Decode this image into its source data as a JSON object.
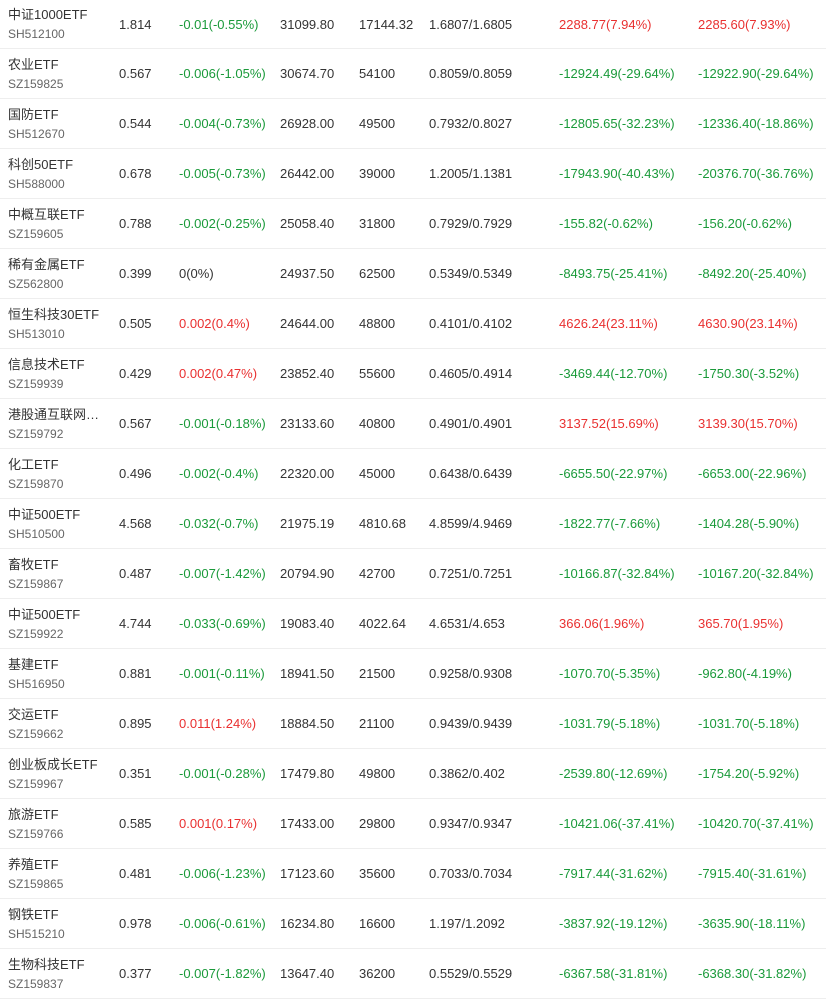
{
  "colors": {
    "up": "#e93030",
    "down": "#1a9a3a",
    "flat": "#333333"
  },
  "rows": [
    {
      "name": "中证1000ETF",
      "code": "SH512100",
      "price": "1.814",
      "change": "-0.01(-0.55%)",
      "change_dir": "down",
      "f1": "31099.80",
      "f2": "17144.32",
      "f3": "1.6807/1.6805",
      "f4": "2288.77(7.94%)",
      "f4_dir": "up",
      "f5": "2285.60(7.93%)",
      "f5_dir": "up"
    },
    {
      "name": "农业ETF",
      "code": "SZ159825",
      "price": "0.567",
      "change": "-0.006(-1.05%)",
      "change_dir": "down",
      "f1": "30674.70",
      "f2": "54100",
      "f3": "0.8059/0.8059",
      "f4": "-12924.49(-29.64%)",
      "f4_dir": "down",
      "f5": "-12922.90(-29.64%)",
      "f5_dir": "down"
    },
    {
      "name": "国防ETF",
      "code": "SH512670",
      "price": "0.544",
      "change": "-0.004(-0.73%)",
      "change_dir": "down",
      "f1": "26928.00",
      "f2": "49500",
      "f3": "0.7932/0.8027",
      "f4": "-12805.65(-32.23%)",
      "f4_dir": "down",
      "f5": "-12336.40(-18.86%)",
      "f5_dir": "down"
    },
    {
      "name": "科创50ETF",
      "code": "SH588000",
      "price": "0.678",
      "change": "-0.005(-0.73%)",
      "change_dir": "down",
      "f1": "26442.00",
      "f2": "39000",
      "f3": "1.2005/1.1381",
      "f4": "-17943.90(-40.43%)",
      "f4_dir": "down",
      "f5": "-20376.70(-36.76%)",
      "f5_dir": "down"
    },
    {
      "name": "中概互联ETF",
      "code": "SZ159605",
      "price": "0.788",
      "change": "-0.002(-0.25%)",
      "change_dir": "down",
      "f1": "25058.40",
      "f2": "31800",
      "f3": "0.7929/0.7929",
      "f4": "-155.82(-0.62%)",
      "f4_dir": "down",
      "f5": "-156.20(-0.62%)",
      "f5_dir": "down"
    },
    {
      "name": "稀有金属ETF",
      "code": "SZ562800",
      "price": "0.399",
      "change": "0(0%)",
      "change_dir": "flat",
      "f1": "24937.50",
      "f2": "62500",
      "f3": "0.5349/0.5349",
      "f4": "-8493.75(-25.41%)",
      "f4_dir": "down",
      "f5": "-8492.20(-25.40%)",
      "f5_dir": "down"
    },
    {
      "name": "恒生科技30ETF",
      "code": "SH513010",
      "price": "0.505",
      "change": "0.002(0.4%)",
      "change_dir": "up",
      "f1": "24644.00",
      "f2": "48800",
      "f3": "0.4101/0.4102",
      "f4": "4626.24(23.11%)",
      "f4_dir": "up",
      "f5": "4630.90(23.14%)",
      "f5_dir": "up"
    },
    {
      "name": "信息技术ETF",
      "code": "SZ159939",
      "price": "0.429",
      "change": "0.002(0.47%)",
      "change_dir": "up",
      "f1": "23852.40",
      "f2": "55600",
      "f3": "0.4605/0.4914",
      "f4": "-3469.44(-12.70%)",
      "f4_dir": "down",
      "f5": "-1750.30(-3.52%)",
      "f5_dir": "down"
    },
    {
      "name": "港股通互联网…",
      "code": "SZ159792",
      "price": "0.567",
      "change": "-0.001(-0.18%)",
      "change_dir": "down",
      "f1": "23133.60",
      "f2": "40800",
      "f3": "0.4901/0.4901",
      "f4": "3137.52(15.69%)",
      "f4_dir": "up",
      "f5": "3139.30(15.70%)",
      "f5_dir": "up"
    },
    {
      "name": "化工ETF",
      "code": "SZ159870",
      "price": "0.496",
      "change": "-0.002(-0.4%)",
      "change_dir": "down",
      "f1": "22320.00",
      "f2": "45000",
      "f3": "0.6438/0.6439",
      "f4": "-6655.50(-22.97%)",
      "f4_dir": "down",
      "f5": "-6653.00(-22.96%)",
      "f5_dir": "down"
    },
    {
      "name": "中证500ETF",
      "code": "SH510500",
      "price": "4.568",
      "change": "-0.032(-0.7%)",
      "change_dir": "down",
      "f1": "21975.19",
      "f2": "4810.68",
      "f3": "4.8599/4.9469",
      "f4": "-1822.77(-7.66%)",
      "f4_dir": "down",
      "f5": "-1404.28(-5.90%)",
      "f5_dir": "down"
    },
    {
      "name": "畜牧ETF",
      "code": "SZ159867",
      "price": "0.487",
      "change": "-0.007(-1.42%)",
      "change_dir": "down",
      "f1": "20794.90",
      "f2": "42700",
      "f3": "0.7251/0.7251",
      "f4": "-10166.87(-32.84%)",
      "f4_dir": "down",
      "f5": "-10167.20(-32.84%)",
      "f5_dir": "down"
    },
    {
      "name": "中证500ETF",
      "code": "SZ159922",
      "price": "4.744",
      "change": "-0.033(-0.69%)",
      "change_dir": "down",
      "f1": "19083.40",
      "f2": "4022.64",
      "f3": "4.6531/4.653",
      "f4": "366.06(1.96%)",
      "f4_dir": "up",
      "f5": "365.70(1.95%)",
      "f5_dir": "up"
    },
    {
      "name": "基建ETF",
      "code": "SH516950",
      "price": "0.881",
      "change": "-0.001(-0.11%)",
      "change_dir": "down",
      "f1": "18941.50",
      "f2": "21500",
      "f3": "0.9258/0.9308",
      "f4": "-1070.70(-5.35%)",
      "f4_dir": "down",
      "f5": "-962.80(-4.19%)",
      "f5_dir": "down"
    },
    {
      "name": "交运ETF",
      "code": "SZ159662",
      "price": "0.895",
      "change": "0.011(1.24%)",
      "change_dir": "up",
      "f1": "18884.50",
      "f2": "21100",
      "f3": "0.9439/0.9439",
      "f4": "-1031.79(-5.18%)",
      "f4_dir": "down",
      "f5": "-1031.70(-5.18%)",
      "f5_dir": "down"
    },
    {
      "name": "创业板成长ETF",
      "code": "SZ159967",
      "price": "0.351",
      "change": "-0.001(-0.28%)",
      "change_dir": "down",
      "f1": "17479.80",
      "f2": "49800",
      "f3": "0.3862/0.402",
      "f4": "-2539.80(-12.69%)",
      "f4_dir": "down",
      "f5": "-1754.20(-5.92%)",
      "f5_dir": "down"
    },
    {
      "name": "旅游ETF",
      "code": "SZ159766",
      "price": "0.585",
      "change": "0.001(0.17%)",
      "change_dir": "up",
      "f1": "17433.00",
      "f2": "29800",
      "f3": "0.9347/0.9347",
      "f4": "-10421.06(-37.41%)",
      "f4_dir": "down",
      "f5": "-10420.70(-37.41%)",
      "f5_dir": "down"
    },
    {
      "name": "养殖ETF",
      "code": "SZ159865",
      "price": "0.481",
      "change": "-0.006(-1.23%)",
      "change_dir": "down",
      "f1": "17123.60",
      "f2": "35600",
      "f3": "0.7033/0.7034",
      "f4": "-7917.44(-31.62%)",
      "f4_dir": "down",
      "f5": "-7915.40(-31.61%)",
      "f5_dir": "down"
    },
    {
      "name": "钢铁ETF",
      "code": "SH515210",
      "price": "0.978",
      "change": "-0.006(-0.61%)",
      "change_dir": "down",
      "f1": "16234.80",
      "f2": "16600",
      "f3": "1.197/1.2092",
      "f4": "-3837.92(-19.12%)",
      "f4_dir": "down",
      "f5": "-3635.90(-18.11%)",
      "f5_dir": "down"
    },
    {
      "name": "生物科技ETF",
      "code": "SZ159837",
      "price": "0.377",
      "change": "-0.007(-1.82%)",
      "change_dir": "down",
      "f1": "13647.40",
      "f2": "36200",
      "f3": "0.5529/0.5529",
      "f4": "-6367.58(-31.81%)",
      "f4_dir": "down",
      "f5": "-6368.30(-31.82%)",
      "f5_dir": "down"
    }
  ]
}
